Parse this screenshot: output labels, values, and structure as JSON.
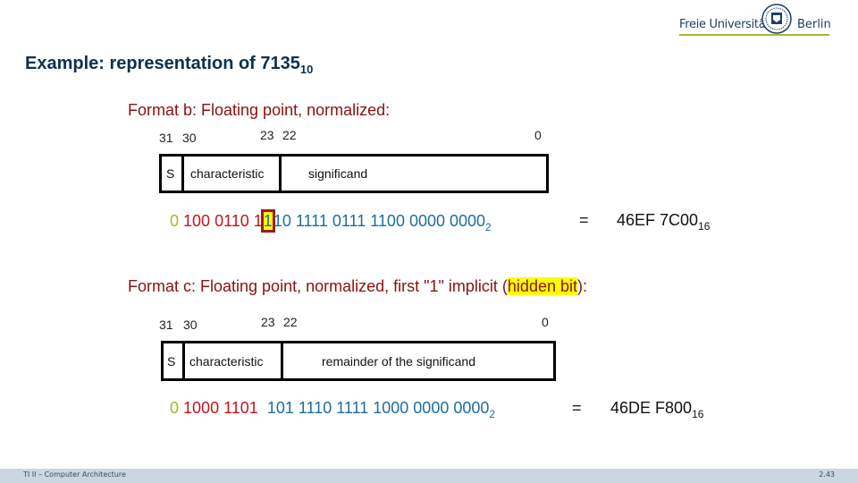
{
  "logo": {
    "left_text": "Freie Universität",
    "right_text": "Berlin",
    "accent_color": "#a7b83a"
  },
  "title": {
    "text": "Example: representation of 7135",
    "subscript": "10"
  },
  "format_b": {
    "heading": "Format b:  Floating point, normalized:",
    "bit_labels": {
      "b31": "31",
      "b30": "30",
      "b23": "23",
      "b22": "22",
      "b0": "0"
    },
    "fields": {
      "sign": "S",
      "exponent": "characteristic",
      "mantissa": "significand"
    },
    "binary": {
      "sign": "0",
      "exponent": "100 0110 1",
      "hidden_bit": "1",
      "mantissa": "10 1111 0111 1100 0000 0000",
      "base": "2"
    },
    "equals": "=",
    "hex": {
      "value": "46EF 7C00",
      "base": "16"
    }
  },
  "format_c": {
    "heading_pre": "Format c: Floating point, normalized, first \"1\" implicit (",
    "heading_highlight": "hidden bit",
    "heading_post": "):",
    "bit_labels": {
      "b31": "31",
      "b30": "30",
      "b23": "23",
      "b22": "22",
      "b0": "0"
    },
    "fields": {
      "sign": "S",
      "exponent": "characteristic",
      "mantissa": "remainder of the significand"
    },
    "binary": {
      "sign": "0",
      "exponent": "1000 1101",
      "mantissa": "101 1110 1111 1000 0000 0000",
      "base": "2"
    },
    "equals": "=",
    "hex": {
      "value": "46DE F800",
      "base": "16"
    }
  },
  "footer": {
    "course": "TI II – Computer Architecture",
    "page": "2.43"
  }
}
